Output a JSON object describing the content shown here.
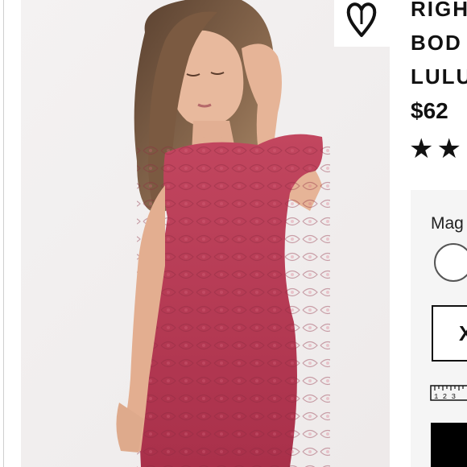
{
  "product": {
    "title_lines": [
      "RIGH",
      "BOD",
      "LULU"
    ],
    "price": "$62",
    "stars_visible": "★★",
    "color_label": "Mag",
    "size_option": "X",
    "ruler_numbers": "1 2 3"
  },
  "icons": {
    "wishlist": "heart-icon",
    "size_guide": "ruler-icon"
  },
  "colors": {
    "dress": "#b83a55",
    "background": "#f2f0f0",
    "panel": "#f5f5f5",
    "text": "#111111"
  }
}
